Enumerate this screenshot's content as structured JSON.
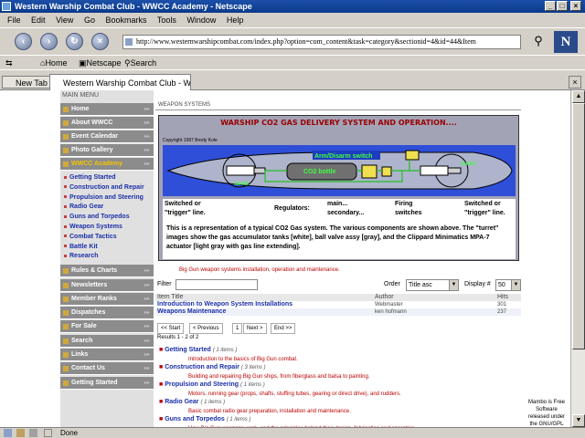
{
  "window": {
    "title": "Western Warship Combat Club - WWCC Academy - Netscape"
  },
  "menubar": [
    "File",
    "Edit",
    "View",
    "Go",
    "Bookmarks",
    "Tools",
    "Window",
    "Help"
  ],
  "address": {
    "url": "http://www.westernwarshipcombat.com/index.php?option=com_content&task=category&sectionid=4&id=44&Item"
  },
  "personal_toolbar": {
    "home": "Home",
    "netscape": "Netscape",
    "search": "Search"
  },
  "tabs": {
    "new_tab": "New Tab",
    "active": "Western Warship Combat Club - W..."
  },
  "sidebar": {
    "title": "MAIN MENU",
    "items": [
      "Home",
      "About WWCC",
      "Event Calendar",
      "Photo Gallery",
      "WWCC Academy"
    ],
    "subitems": [
      "Getting Started",
      "Construction and Repair",
      "Propulsion and Steering",
      "Radio Gear",
      "Guns and Torpedos",
      "Weapon Systems",
      "Combat Tactics",
      "Battle Kit",
      "Research"
    ],
    "items2": [
      "Rules & Charts",
      "Newsletters",
      "Member Ranks",
      "Dispatches",
      "For Sale",
      "Search",
      "Links",
      "Contact Us",
      "Getting Started"
    ]
  },
  "main": {
    "section_title": "WEAPON SYSTEMS",
    "figure": {
      "title": "WARSHIP CO2 GAS DELIVERY SYSTEM AND OPERATION....",
      "copyright": "Copyright 1997 Brody Kole",
      "diagram_labels": [
        "Arm/Disarm switch",
        "CO2 bottle",
        "turret",
        "turret"
      ],
      "labels": [
        "Switched or",
        "\"trigger\" line.",
        "Regulators:",
        "main...",
        "secondary...",
        "Firing",
        "switches",
        "Switched or",
        "\"trigger\" line."
      ],
      "caption": "This is a representation of a typical CO2 Gas system.  The various components are shown above.  The \"turret\" images show the gas accumulator tanks [white], ball valve assy [gray], and the Clippard Minimatics MPA-7 actuator [light gray with gas line extending]."
    },
    "description": "Big Gun weapon systems installation, operation and maintenance.",
    "filter": {
      "label": "Filter",
      "value": "",
      "order_label": "Order",
      "order_value": "Title asc",
      "display_label": "Display #",
      "display_value": "50"
    },
    "table": {
      "headers": [
        "Item Title",
        "Author",
        "Hits"
      ],
      "rows": [
        {
          "title": "Introduction to Weapon System Installations",
          "author": "Webmaster",
          "hits": "301"
        },
        {
          "title": "Weapons Maintenance",
          "author": "ken hofmann",
          "hits": "237"
        }
      ]
    },
    "pager": [
      "<< Start",
      "< Previous",
      "1",
      "Next >",
      "End >>"
    ],
    "results": "Results 1 - 2 of 2",
    "categories": [
      {
        "name": "Getting Started",
        "count": "( 1 items )",
        "desc": "Introduction to the basics of Big Gun combat."
      },
      {
        "name": "Construction and Repair",
        "count": "( 3 items )",
        "desc": "Building and repairing Big Gun ships, from fiberglass and balsa to painting."
      },
      {
        "name": "Propulsion and Steering",
        "count": "( 1 items )",
        "desc": "Motors, running gear (props, shafts, stuffing tubes, gearing or direct drive), and rudders."
      },
      {
        "name": "Radio Gear",
        "count": "( 1 items )",
        "desc": "Basic combat radio gear preparation, installation and maintenance."
      },
      {
        "name": "Guns and Torpedos",
        "count": "( 1 items )",
        "desc": "How Big Gun weapons work, and the principles behind their design, fabrication and operation."
      }
    ],
    "mambo": "Mambo is Free Software released under the GNU/GPL"
  },
  "status": {
    "text": "Done"
  }
}
